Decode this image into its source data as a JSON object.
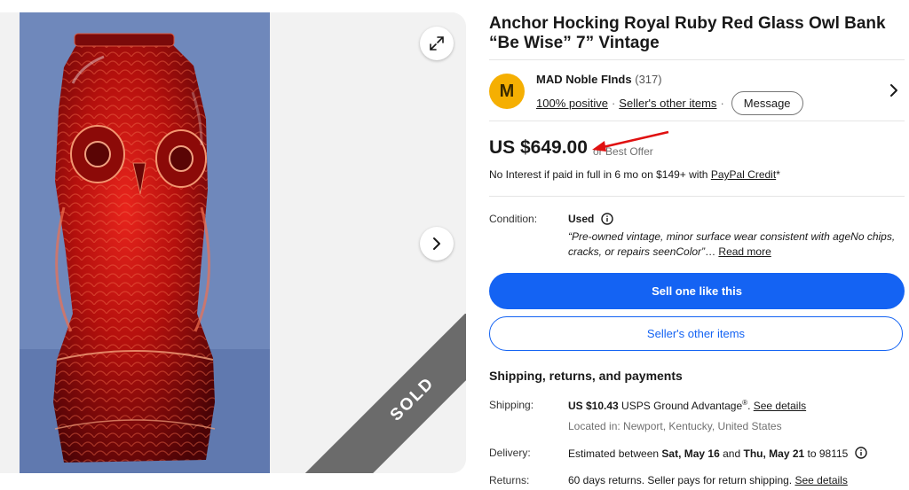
{
  "gallery": {
    "sold_label": "SOLD",
    "expand_icon": "expand-arrows-icon",
    "next_icon": "chevron-right-icon"
  },
  "listing": {
    "title": "Anchor Hocking Royal Ruby Red Glass Owl Bank “Be Wise” 7” Vintage"
  },
  "seller": {
    "avatar_letter": "M",
    "avatar_color": "#f5af02",
    "name": "MAD Noble FInds",
    "count": "(317)",
    "positive": "100% positive",
    "other_items_link": "Seller's other items",
    "message_button": "Message"
  },
  "price": {
    "amount": "US $649.00",
    "best_offer": "or Best Offer",
    "annotation_arrow_color": "#e01010"
  },
  "financing": {
    "prefix": "No Interest if paid in full in 6 mo on $149+ with ",
    "link": "PayPal Credit",
    "suffix": "*"
  },
  "condition": {
    "label": "Condition:",
    "value": "Used",
    "description": "“Pre-owned vintage, minor surface wear consistent with ageNo chips, cracks, or repairs seenColor”",
    "ellipsis": "…",
    "read_more": "Read more"
  },
  "actions": {
    "primary": "Sell one like this",
    "secondary": "Seller's other items",
    "primary_color": "#1463f3"
  },
  "shipping": {
    "heading": "Shipping, returns, and payments",
    "shipping_label": "Shipping:",
    "shipping_cost": "US $10.43",
    "shipping_service": " USPS Ground Advantage",
    "shipping_reg": "®",
    "shipping_sep": ". ",
    "shipping_link": "See details",
    "location": "Located in: Newport, Kentucky, United States",
    "delivery_label": "Delivery:",
    "delivery_prefix": "Estimated between ",
    "delivery_start": "Sat, May 16",
    "delivery_and": " and ",
    "delivery_end": "Thu, May 21",
    "delivery_to": " to 98115",
    "returns_label": "Returns:",
    "returns_text": "60 days returns. Seller pays for return shipping. ",
    "returns_link": "See details"
  }
}
